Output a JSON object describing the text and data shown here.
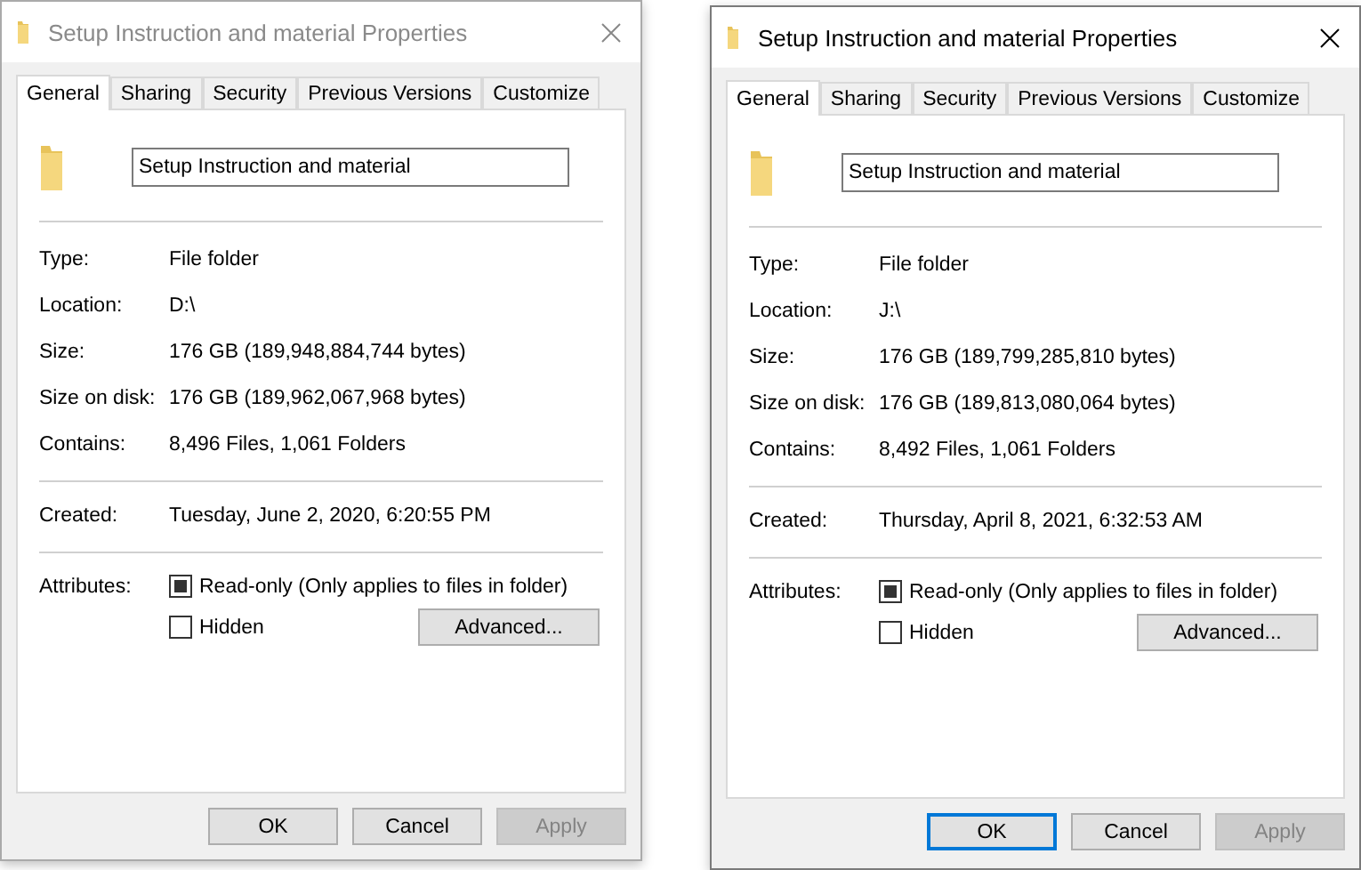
{
  "dialogs": [
    {
      "title": "Setup Instruction and material Properties",
      "active": false,
      "tabs": [
        {
          "label": "General",
          "selected": true
        },
        {
          "label": "Sharing",
          "selected": false
        },
        {
          "label": "Security",
          "selected": false
        },
        {
          "label": "Previous Versions",
          "selected": false
        },
        {
          "label": "Customize",
          "selected": false
        }
      ],
      "name_field": {
        "value": "Setup Instruction and material"
      },
      "groups": [
        [
          {
            "label": "Type:",
            "value": "File folder"
          },
          {
            "label": "Location:",
            "value": "D:\\"
          },
          {
            "label": "Size:",
            "value": "176 GB (189,948,884,744 bytes)"
          },
          {
            "label": "Size on disk:",
            "value": "176 GB (189,962,067,968 bytes)"
          },
          {
            "label": "Contains:",
            "value": "8,496 Files, 1,061 Folders"
          }
        ],
        [
          {
            "label": "Created:",
            "value": "Tuesday, June 2, 2020, 6:20:55 PM"
          }
        ]
      ],
      "attributes_label": "Attributes:",
      "attributes": [
        {
          "label": "Read-only (Only applies to files in folder)",
          "checked": true
        },
        {
          "label": "Hidden",
          "checked": false
        }
      ],
      "advanced_button": "Advanced...",
      "buttons": [
        {
          "label": "OK",
          "focused": false,
          "disabled": false
        },
        {
          "label": "Cancel",
          "focused": false,
          "disabled": false
        },
        {
          "label": "Apply",
          "focused": false,
          "disabled": true
        }
      ]
    },
    {
      "title": "Setup Instruction and material Properties",
      "active": true,
      "tabs": [
        {
          "label": "General",
          "selected": true
        },
        {
          "label": "Sharing",
          "selected": false
        },
        {
          "label": "Security",
          "selected": false
        },
        {
          "label": "Previous Versions",
          "selected": false
        },
        {
          "label": "Customize",
          "selected": false
        }
      ],
      "name_field": {
        "value": "Setup Instruction and material"
      },
      "groups": [
        [
          {
            "label": "Type:",
            "value": "File folder"
          },
          {
            "label": "Location:",
            "value": "J:\\"
          },
          {
            "label": "Size:",
            "value": "176 GB (189,799,285,810 bytes)"
          },
          {
            "label": "Size on disk:",
            "value": "176 GB (189,813,080,064 bytes)"
          },
          {
            "label": "Contains:",
            "value": "8,492 Files, 1,061 Folders"
          }
        ],
        [
          {
            "label": "Created:",
            "value": "Thursday, April 8, 2021, 6:32:53 AM"
          }
        ]
      ],
      "attributes_label": "Attributes:",
      "attributes": [
        {
          "label": "Read-only (Only applies to files in folder)",
          "checked": true
        },
        {
          "label": "Hidden",
          "checked": false
        }
      ],
      "advanced_button": "Advanced...",
      "buttons": [
        {
          "label": "OK",
          "focused": true,
          "disabled": false
        },
        {
          "label": "Cancel",
          "focused": false,
          "disabled": false
        },
        {
          "label": "Apply",
          "focused": false,
          "disabled": true
        }
      ]
    }
  ]
}
